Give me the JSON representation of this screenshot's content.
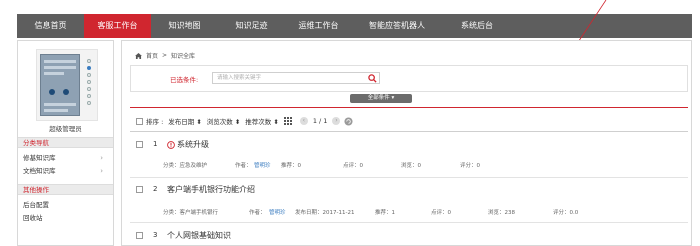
{
  "nav": {
    "items": [
      {
        "label": "信息首页",
        "active": false
      },
      {
        "label": "客服工作台",
        "active": true
      },
      {
        "label": "知识地图",
        "active": false
      },
      {
        "label": "知识足迹",
        "active": false
      },
      {
        "label": "运维工作台",
        "active": false
      },
      {
        "label": "智能应答机器人",
        "active": false
      },
      {
        "label": "系统后台",
        "active": false
      }
    ]
  },
  "sidebar": {
    "user_name": "超级管理员",
    "section1_title": "分类导航",
    "section1_items": [
      "修基知识库",
      "文档知识库"
    ],
    "section2_title": "其他操作",
    "section2_items": [
      "后台配置",
      "回收站"
    ]
  },
  "breadcrumb": {
    "home": "首页",
    "separator": ">",
    "current": "知识全库"
  },
  "filter": {
    "label": "已选条件:",
    "search_placeholder": "请输入搜索关键字",
    "all_conditions_label": "全部条件 ▾"
  },
  "toolbar": {
    "sort_label": "排序 :",
    "sort_options": [
      "发布日期 ⬍",
      "浏览次数 ⬍",
      "推荐次数 ⬍"
    ],
    "prev": "‹",
    "page_indicator": "1 / 1",
    "next": "›"
  },
  "results": [
    {
      "index": "1",
      "title": "系统升级",
      "alert": true,
      "meta": {
        "category": "分类：应急及维护",
        "author_label": "作者：",
        "author": "管明珍",
        "recommend": "推荐：0",
        "comments": "点评：0",
        "views": "浏览：0",
        "rating": "评分：0"
      }
    },
    {
      "index": "2",
      "title": "客户端手机银行功能介绍",
      "alert": false,
      "meta": {
        "category": "分类：客户端手机银行",
        "author_label": "作者：",
        "author": "管明珍",
        "date": "发布日期：2017-11-21",
        "recommend": "推荐：1",
        "comments": "点评：0",
        "views": "浏览：238",
        "rating": "评分：0.0"
      }
    },
    {
      "index": "3",
      "title": "个人网银基础知识",
      "alert": false
    }
  ],
  "colors": {
    "accent": "#d0262f",
    "nav_bg": "#5e5e5e",
    "link": "#3a7cc0"
  }
}
